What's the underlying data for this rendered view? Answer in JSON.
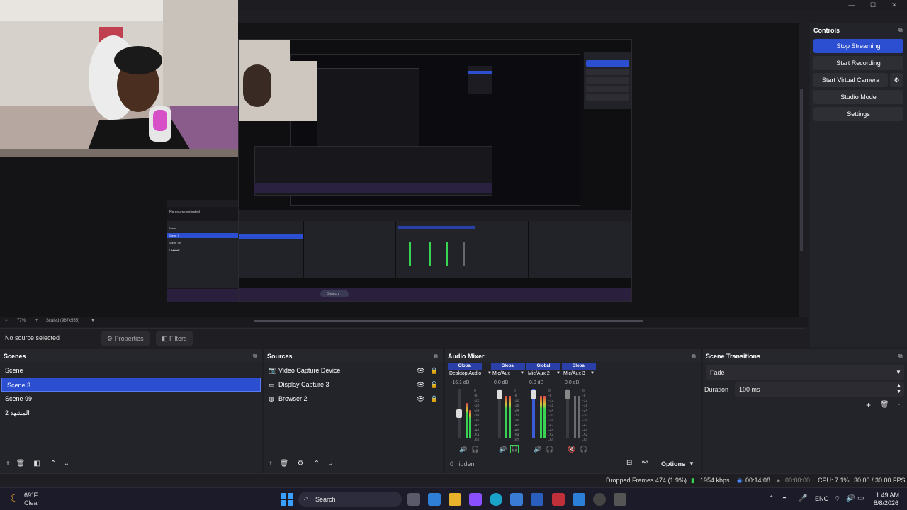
{
  "window": {
    "minimize": "—",
    "maximize": "☐",
    "close": "✕"
  },
  "preview": {
    "zoom_text": "77%",
    "scale_text": "Scaled (987x555)",
    "nested_no_source": "No source selected",
    "nested_properties": "Properties",
    "nested_filters": "Filters",
    "nested_scenes": [
      "Scene",
      "Scene 3",
      "Scene 99",
      "المشهد 2"
    ],
    "nested_sources": [
      "Video Capture Device",
      "Display Capture 3",
      "Browser 2"
    ],
    "nested_search": "Search"
  },
  "source_toolbar": {
    "status": "No source selected",
    "properties": "Properties",
    "filters": "Filters"
  },
  "controls": {
    "title": "Controls",
    "stop_streaming": "Stop Streaming",
    "start_recording": "Start Recording",
    "start_virtual_camera": "Start Virtual Camera",
    "studio_mode": "Studio Mode",
    "settings": "Settings"
  },
  "scenes": {
    "title": "Scenes",
    "items": [
      "Scene",
      "Scene 3",
      "Scene 99",
      "المشهد 2"
    ],
    "selected_index": 1
  },
  "sources": {
    "title": "Sources",
    "items": [
      {
        "label": "Video Capture Device",
        "icon": "camera-icon"
      },
      {
        "label": "Display Capture 3",
        "icon": "monitor-icon"
      },
      {
        "label": "Browser 2",
        "icon": "globe-icon"
      }
    ]
  },
  "audio_mixer": {
    "title": "Audio Mixer",
    "channels": [
      {
        "global": "Global",
        "name": "Desktop Audio",
        "db": "-16.1 dB",
        "active_color": "#39d353"
      },
      {
        "global": "Global",
        "name": "Mic/Aux",
        "db": "0.0 dB",
        "active_color": "#39d353"
      },
      {
        "global": "Global",
        "name": "Mic/Aux 2",
        "db": "0.0 dB",
        "active_color": "#39d353"
      },
      {
        "global": "Global",
        "name": "Mic/Aux 3",
        "db": "0.0 dB",
        "active_color": "#888888"
      }
    ],
    "scale": [
      "0",
      "-6",
      "-12",
      "-18",
      "-24",
      "-30",
      "-36",
      "-42",
      "-48",
      "-54",
      "-60"
    ],
    "hidden_text": "0 hidden",
    "options": "Options"
  },
  "transitions": {
    "title": "Scene Transitions",
    "selected": "Fade",
    "duration_label": "Duration",
    "duration_value": "100 ms"
  },
  "status": {
    "dropped_frames": "Dropped Frames 474 (1.9%)",
    "bitrate": "1954 kbps",
    "stream_time": "00:14:08",
    "record_time": "00:00:00",
    "cpu": "CPU: 7.1%",
    "fps": "30.00 / 30.00 FPS"
  },
  "taskbar": {
    "weather_temp": "69°F",
    "weather_desc": "Clear",
    "search": "Search",
    "lang": "ENG",
    "time": "1:49 AM",
    "date": "8/8/2026"
  },
  "colors": {
    "accent": "#2c4fd1",
    "panel": "#23232a",
    "meter_green": "#39d353"
  }
}
